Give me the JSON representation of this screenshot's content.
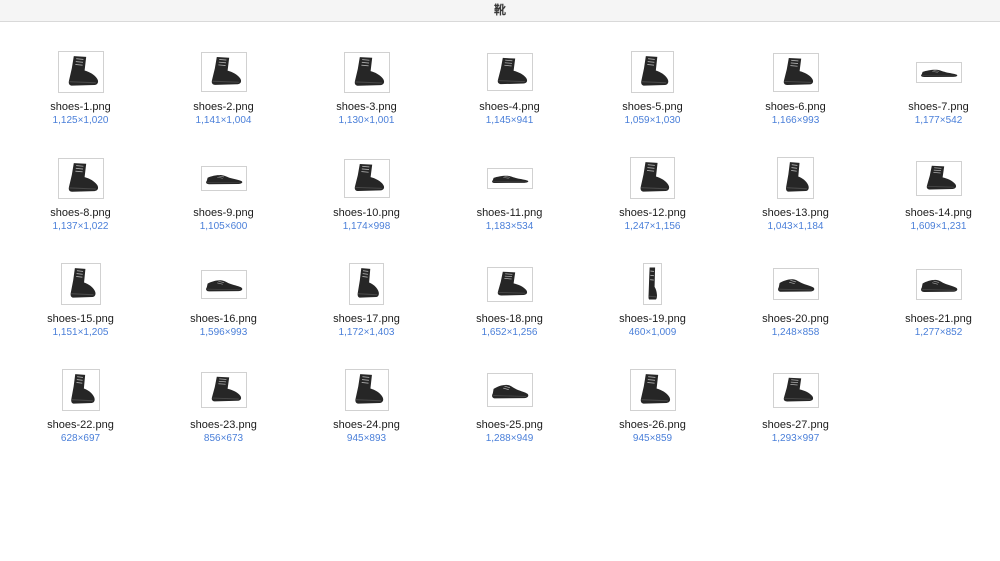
{
  "window": {
    "title": "靴"
  },
  "colors": {
    "titlebar_bg": "#f5f5f5",
    "filename_text": "#1c1c1c",
    "dims_text": "#4a7fd9"
  },
  "grid": {
    "columns": 7
  },
  "files": [
    {
      "name": "shoes-1.png",
      "info": "1,125×1,020"
    },
    {
      "name": "shoes-2.png",
      "info": "1,141×1,004"
    },
    {
      "name": "shoes-3.png",
      "info": "1,130×1,001"
    },
    {
      "name": "shoes-4.png",
      "info": "1,145×941"
    },
    {
      "name": "shoes-5.png",
      "info": "1,059×1,030"
    },
    {
      "name": "shoes-6.png",
      "info": "1,166×993"
    },
    {
      "name": "shoes-7.png",
      "info": "1,177×542"
    },
    {
      "name": "shoes-8.png",
      "info": "1,137×1,022"
    },
    {
      "name": "shoes-9.png",
      "info": "1,105×600"
    },
    {
      "name": "shoes-10.png",
      "info": "1,174×998"
    },
    {
      "name": "shoes-11.png",
      "info": "1,183×534"
    },
    {
      "name": "shoes-12.png",
      "info": "1,247×1,156"
    },
    {
      "name": "shoes-13.png",
      "info": "1,043×1,184"
    },
    {
      "name": "shoes-14.png",
      "info": "1,609×1,231"
    },
    {
      "name": "shoes-15.png",
      "info": "1,151×1,205"
    },
    {
      "name": "shoes-16.png",
      "info": "1,596×993"
    },
    {
      "name": "shoes-17.png",
      "info": "1,172×1,403"
    },
    {
      "name": "shoes-18.png",
      "info": "1,652×1,256"
    },
    {
      "name": "shoes-19.png",
      "info": "460×1,009"
    },
    {
      "name": "shoes-20.png",
      "info": "1,248×858"
    },
    {
      "name": "shoes-21.png",
      "info": "1,277×852"
    },
    {
      "name": "shoes-22.png",
      "info": "628×697"
    },
    {
      "name": "shoes-23.png",
      "info": "856×673"
    },
    {
      "name": "shoes-24.png",
      "info": "945×893"
    },
    {
      "name": "shoes-25.png",
      "info": "1,288×949"
    },
    {
      "name": "shoes-26.png",
      "info": "945×859"
    },
    {
      "name": "shoes-27.png",
      "info": "1,293×997"
    }
  ]
}
